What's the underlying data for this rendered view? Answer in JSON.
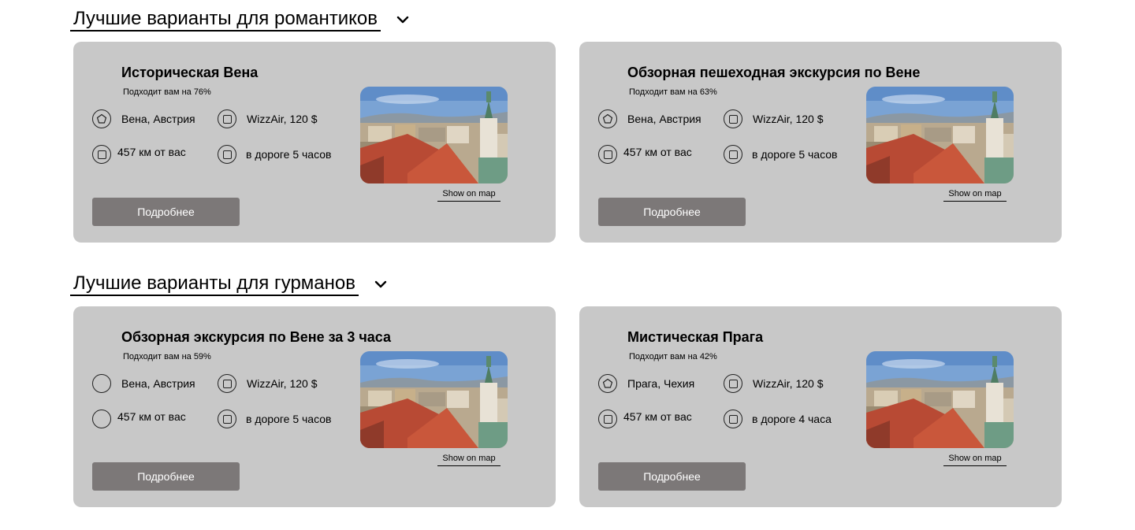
{
  "sections": [
    {
      "title": "Лучшие варианты для романтиков",
      "cards": [
        {
          "title": "Историческая Вена",
          "match": "Подходит вам на 76%",
          "location": "Вена, Австрия",
          "flight": "WizzAir, 120 $",
          "distance": "457 км от вас",
          "duration": "в дороге 5 часов",
          "map_link": "Show on map",
          "button": "Подробнее"
        },
        {
          "title": "Обзорная пешеходная экскурсия по Вене",
          "match": "Подходит вам на 63%",
          "location": "Вена, Австрия",
          "flight": "WizzAir, 120 $",
          "distance": "457 км от вас",
          "duration": "в дороге 5 часов",
          "map_link": "Show on map",
          "button": "Подробнее"
        }
      ]
    },
    {
      "title": "Лучшие варианты для гурманов",
      "cards": [
        {
          "title": "Обзорная экскурсия по Вене за 3 часа",
          "match": "Подходит вам на 59%",
          "location": "Вена, Австрия",
          "flight": "WizzAir, 120 $",
          "distance": "457 км от вас",
          "duration": "в дороге 5 часов",
          "map_link": "Show on map",
          "button": "Подробнее"
        },
        {
          "title": "Мистическая Прага",
          "match": "Подходит вам на 42%",
          "location": "Прага, Чехия",
          "flight": "WizzAir, 120 $",
          "distance": "457 км от вас",
          "duration": "в дороге 4 часа",
          "map_link": "Show on map",
          "button": "Подробнее"
        }
      ]
    }
  ],
  "icons": {
    "section_toggle": "chevron-down-icon",
    "location": "pentagon-icon",
    "feature": "square-icon",
    "photo": "city-photo"
  },
  "colors": {
    "card_bg": "#c8c8c8",
    "button_bg": "#7c7878",
    "button_text": "#ffffff"
  }
}
